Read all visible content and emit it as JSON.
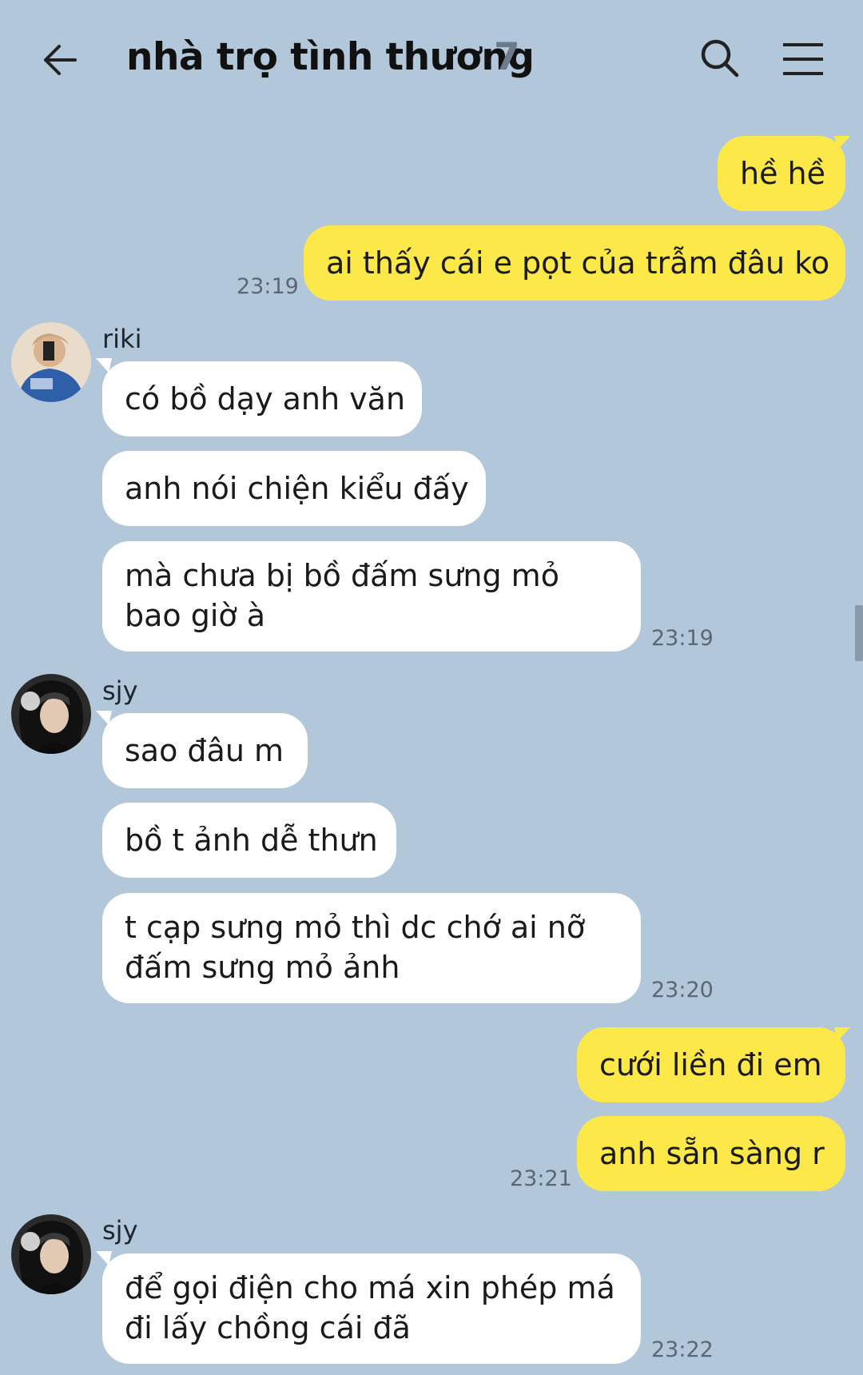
{
  "header": {
    "title": "nhà trọ tình thương",
    "member_count": "7"
  },
  "messages": {
    "m1": "hề hề",
    "m2": "ai thấy cái e pọt của trẫm đâu ko",
    "t1": "23:19",
    "riki_name": "riki",
    "m3": "có bồ dạy anh văn",
    "m4": "anh nói chiện kiểu đấy",
    "m5": "mà chưa bị bồ đấm sưng mỏ bao giờ à",
    "t2": "23:19",
    "sjy_name": "sjy",
    "m6": "sao đâu m",
    "m7": "bồ t ảnh dễ thưn",
    "m8": "t cạp sưng mỏ thì dc chớ ai nỡ đấm sưng mỏ ảnh",
    "t3": "23:20",
    "m9": "cưới liền đi em",
    "m10": "anh sẵn sàng r",
    "t4": "23:21",
    "sjy_name_2": "sjy",
    "m11": "để gọi điện cho má xin phép má đi lấy chồng cái đã",
    "t5": "23:22"
  },
  "colors": {
    "background": "#b3c7da",
    "outgoing_bubble": "#fde84a",
    "incoming_bubble": "#ffffff"
  }
}
